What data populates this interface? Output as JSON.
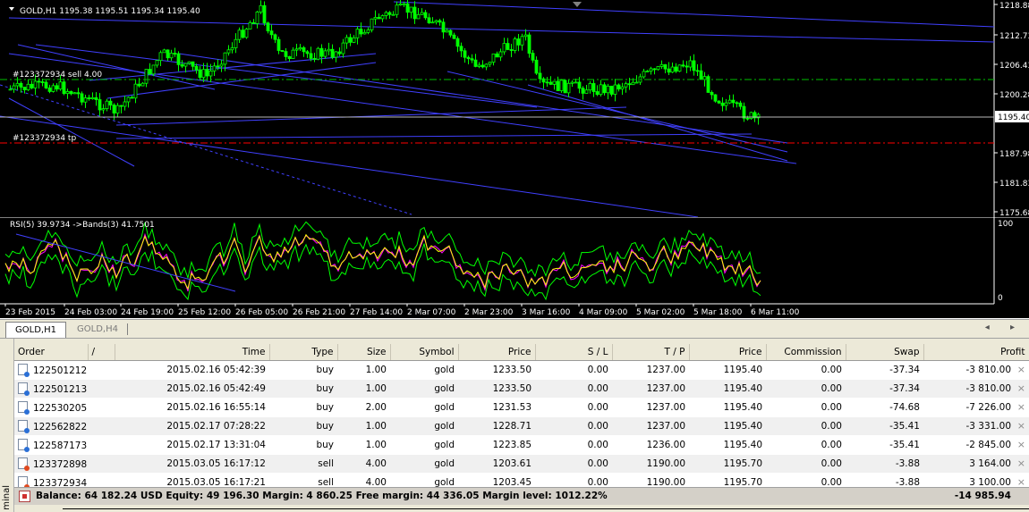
{
  "main_chart": {
    "info_label": "GOLD,H1  1195.38 1195.51 1195.34 1195.40",
    "order_label_sell": "#123372934 sell 4.00",
    "order_label_tp": "#123372934 tp",
    "price_ticks": [
      "1218.88",
      "1212.73",
      "1206.43",
      "1200.28",
      "1194.13",
      "1187.98",
      "1181.83",
      "1175.68"
    ],
    "current_price": "1195.40",
    "candle_up_color": "#00ff00",
    "candle_down_color": "#00ff00",
    "sell_line_color": "#00c000",
    "tp_line_color": "#ff0000",
    "trendline_color": "#4040ff"
  },
  "rsi_chart": {
    "info_label": "RSI(5) 39.9734  ->Bands(3) 41.7501",
    "scale_top": "100",
    "scale_bottom": "0",
    "rsi_color": "#ffff00",
    "band_color": "#00ff00",
    "mid_color": "#ff00ff"
  },
  "time_axis": {
    "labels": [
      "23 Feb 2015",
      "24 Feb 03:00",
      "24 Feb 19:00",
      "25 Feb 12:00",
      "26 Feb 05:00",
      "26 Feb 21:00",
      "27 Feb 14:00",
      "2 Mar 07:00",
      "2 Mar 23:00",
      "3 Mar 16:00",
      "4 Mar 09:00",
      "5 Mar 02:00",
      "5 Mar 18:00",
      "6 Mar 11:00"
    ]
  },
  "chart_tabs": [
    {
      "label": "GOLD,H1",
      "active": true
    },
    {
      "label": "GOLD,H4",
      "active": false
    }
  ],
  "scroll_arrows": "◂ ▸",
  "terminal": {
    "sidebar_label": "minal",
    "columns": [
      "Order",
      "/",
      "Time",
      "Type",
      "Size",
      "Symbol",
      "Price",
      "S / L",
      "T / P",
      "Price",
      "Commission",
      "Swap",
      "Profit"
    ],
    "orders": [
      {
        "order": "122501212",
        "time": "2015.02.16 05:42:39",
        "type": "buy",
        "size": "1.00",
        "symbol": "gold",
        "open_price": "1233.50",
        "sl": "0.00",
        "tp": "1237.00",
        "price": "1195.40",
        "commission": "0.00",
        "swap": "-37.34",
        "profit": "-3 810.00"
      },
      {
        "order": "122501213",
        "time": "2015.02.16 05:42:49",
        "type": "buy",
        "size": "1.00",
        "symbol": "gold",
        "open_price": "1233.50",
        "sl": "0.00",
        "tp": "1237.00",
        "price": "1195.40",
        "commission": "0.00",
        "swap": "-37.34",
        "profit": "-3 810.00"
      },
      {
        "order": "122530205",
        "time": "2015.02.16 16:55:14",
        "type": "buy",
        "size": "2.00",
        "symbol": "gold",
        "open_price": "1231.53",
        "sl": "0.00",
        "tp": "1237.00",
        "price": "1195.40",
        "commission": "0.00",
        "swap": "-74.68",
        "profit": "-7 226.00"
      },
      {
        "order": "122562822",
        "time": "2015.02.17 07:28:22",
        "type": "buy",
        "size": "1.00",
        "symbol": "gold",
        "open_price": "1228.71",
        "sl": "0.00",
        "tp": "1237.00",
        "price": "1195.40",
        "commission": "0.00",
        "swap": "-35.41",
        "profit": "-3 331.00"
      },
      {
        "order": "122587173",
        "time": "2015.02.17 13:31:04",
        "type": "buy",
        "size": "1.00",
        "symbol": "gold",
        "open_price": "1223.85",
        "sl": "0.00",
        "tp": "1236.00",
        "price": "1195.40",
        "commission": "0.00",
        "swap": "-35.41",
        "profit": "-2 845.00"
      },
      {
        "order": "123372898",
        "time": "2015.03.05 16:17:12",
        "type": "sell",
        "size": "4.00",
        "symbol": "gold",
        "open_price": "1203.61",
        "sl": "0.00",
        "tp": "1190.00",
        "price": "1195.70",
        "commission": "0.00",
        "swap": "-3.88",
        "profit": "3 164.00"
      },
      {
        "order": "123372934",
        "time": "2015.03.05 16:17:21",
        "type": "sell",
        "size": "4.00",
        "symbol": "gold",
        "open_price": "1203.45",
        "sl": "0.00",
        "tp": "1190.00",
        "price": "1195.70",
        "commission": "0.00",
        "swap": "-3.88",
        "profit": "3 100.00"
      }
    ],
    "close_glyph": "×",
    "balance_text": "Balance: 64 182.24 USD  Equity: 49 196.30  Margin: 4 860.25  Free margin: 44 336.05  Margin level: 1012.22%",
    "total_profit": "-14 985.94"
  }
}
